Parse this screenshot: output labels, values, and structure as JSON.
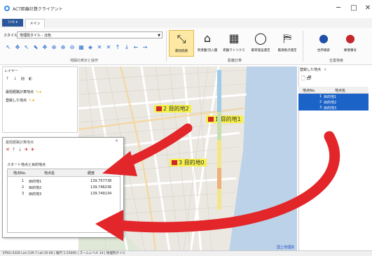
{
  "window": {
    "title": "ACT距離計算クライアント",
    "controls": [
      "─",
      "□",
      "✕"
    ]
  },
  "ribbon": {
    "file_tab": "ﾌｧｲﾙ ▾",
    "main_tab": "メイン",
    "style_label": "スタイル",
    "style_value": "地理院タイル - 淡色",
    "map_tools": [
      "↖",
      "✥",
      "↖",
      "⬉",
      "✥",
      "⊕",
      "⊕",
      "⊖",
      "▦",
      "◈",
      "✕",
      "✕",
      "↑",
      "↓",
      "←",
      "→"
    ],
    "map_group_label": "地図の表示と操作",
    "distance_buttons": [
      {
        "label": "最短経路",
        "icon": "⤡",
        "active": true
      },
      {
        "label": "到達圏/流入圏",
        "icon": "⌂",
        "active": false
      },
      {
        "label": "距離マトリクス",
        "icon": "▦",
        "active": false
      },
      {
        "label": "最寄施設選定",
        "icon": "◯",
        "active": false
      },
      {
        "label": "最適拠点選定",
        "icon": "⛿",
        "active": false
      }
    ],
    "distance_group_label": "距離計算",
    "search_buttons": [
      {
        "label": "住所検索",
        "icon": "●"
      },
      {
        "label": "郵便番号",
        "icon": "●"
      }
    ],
    "search_group_label": "位置検索"
  },
  "layer_panel": {
    "title": "レイヤー",
    "items": [
      "最短経路計算地点",
      "登録した地点"
    ]
  },
  "map": {
    "markers": [
      {
        "label": "2 目的地2"
      },
      {
        "label": "1 目的地1"
      },
      {
        "label": "3 目的地0"
      }
    ],
    "copyright": "国土地理院"
  },
  "registered_panel": {
    "tab": "登録した地点",
    "close": "×",
    "toolbar": "🗋 🗗",
    "headers": [
      "地点No.",
      "地点名"
    ],
    "rows": [
      {
        "no": "1",
        "name": "目的地1"
      },
      {
        "no": "2",
        "name": "目的地2"
      },
      {
        "no": "3",
        "name": "目的地3"
      }
    ]
  },
  "dialog": {
    "title": "最短経路計算地点",
    "close": "×",
    "subtitle": "スタート地点と目的地点",
    "headers": [
      "地点No.",
      "地点名",
      "経度"
    ],
    "rows": [
      {
        "no": "1",
        "name": "目的地1",
        "lon": "139.757738"
      },
      {
        "no": "2",
        "name": "目的地2",
        "lon": "139.746236"
      },
      {
        "no": "3",
        "name": "目的地3",
        "lon": "139.749134"
      }
    ]
  },
  "status_bar": {
    "text": "EPSG:4326  Lon:139.7  Lat:35.66  |  縮尺 1:25000  |  ズームレベル 14  |  地理院タイル"
  },
  "colors": {
    "ribbon_accent": "#2b579a",
    "selection": "#1c63c7",
    "arrow": "#e2262a",
    "marker_highlight": "#f5f04a"
  }
}
